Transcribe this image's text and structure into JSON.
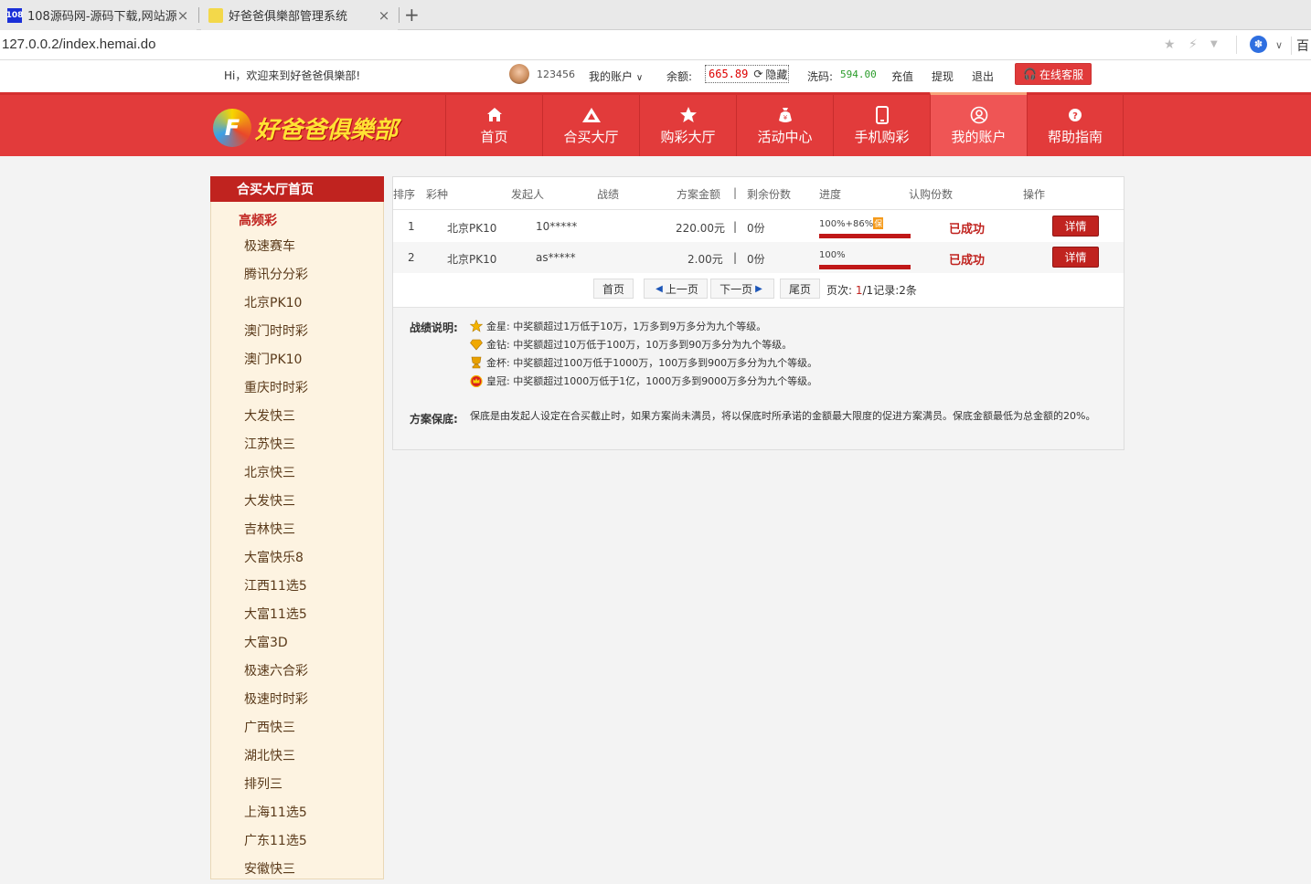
{
  "browser": {
    "tabs": [
      {
        "favicon": "108",
        "title": "108源码网-源码下载,网站源码"
      },
      {
        "favicon": "",
        "title": "好爸爸俱樂部管理系统"
      }
    ],
    "url": "127.0.0.2/index.hemai.do",
    "right_text": "百"
  },
  "topbar": {
    "welcome": "Hi，欢迎来到好爸爸俱樂部!",
    "username": "123456",
    "my_account": "我的账户",
    "balance_label": "余额:",
    "balance": "665.89",
    "hide": "隐藏",
    "xima_label": "洗码:",
    "xima_value": "594.00",
    "recharge": "充值",
    "withdraw": "提现",
    "logout": "退出",
    "service": "在线客服"
  },
  "logo": {
    "mark": "F",
    "text": "好爸爸俱樂部"
  },
  "nav": [
    {
      "label": "首页",
      "icon": "home-icon"
    },
    {
      "label": "合买大厅",
      "icon": "triangle-icon"
    },
    {
      "label": "购彩大厅",
      "icon": "star-icon"
    },
    {
      "label": "活动中心",
      "icon": "moneybag-icon"
    },
    {
      "label": "手机购彩",
      "icon": "phone-icon"
    },
    {
      "label": "我的账户",
      "icon": "user-icon"
    },
    {
      "label": "帮助指南",
      "icon": "help-icon"
    }
  ],
  "sidebar": {
    "head": "合买大厅首页",
    "category": "高频彩",
    "items": [
      "极速赛车",
      "腾讯分分彩",
      "北京PK10",
      "澳门时时彩",
      "澳门PK10",
      "重庆时时彩",
      "大发快三",
      "江苏快三",
      "北京快三",
      "大发快三",
      "吉林快三",
      "大富快乐8",
      "江西11选5",
      "大富11选5",
      "大富3D",
      "极速六合彩",
      "极速时时彩",
      "广西快三",
      "湖北快三",
      "排列三",
      "上海11选5",
      "广东11选5",
      "安徽快三"
    ]
  },
  "table": {
    "headers": [
      "排序",
      "彩种",
      "发起人",
      "战绩",
      "方案金额",
      "|",
      "剩余份数",
      "进度",
      "认购份数",
      "操作"
    ],
    "rows": [
      {
        "rank": "1",
        "game": "北京PK10",
        "starter": "10*****",
        "amount": "220.00元",
        "sep": "|",
        "remain": "0份",
        "progress": "100%+86%",
        "bao": "保",
        "progress_pct": 1.0,
        "status": "已成功",
        "action": "详情"
      },
      {
        "rank": "2",
        "game": "北京PK10",
        "starter": "as*****",
        "amount": "2.00元",
        "sep": "|",
        "remain": "0份",
        "progress": "100%",
        "bao": "",
        "progress_pct": 1.0,
        "status": "已成功",
        "action": "详情"
      }
    ]
  },
  "pager": {
    "first": "首页",
    "prev": "上一页",
    "next": "下一页",
    "last": "尾页",
    "page_label": "页次:",
    "page": "1",
    "page_total": "/1",
    "records_label": "记录:",
    "records": "2条"
  },
  "legend": {
    "title": "战绩说明:",
    "items": [
      {
        "icon": "gold-star-icon",
        "color": "#f5b400",
        "text": "金星: 中奖额超过1万低于10万，1万多到9万多分为九个等级。"
      },
      {
        "icon": "gold-diamond-icon",
        "color": "#f0a800",
        "text": "金钻: 中奖额超过10万低于100万，10万多到90万多分为九个等级。"
      },
      {
        "icon": "gold-cup-icon",
        "color": "#e8a000",
        "text": "金杯: 中奖额超过100万低于1000万，100万多到900万多分为九个等级。"
      },
      {
        "icon": "crown-icon",
        "color": "#d81e1e",
        "text": "皇冠: 中奖额超过1000万低于1亿，1000万多到9000万多分为九个等级。"
      }
    ],
    "guarantee_title": "方案保底:",
    "guarantee_text": "保底是由发起人设定在合买截止时，如果方案尚未满员，将以保底时所承诺的金额最大限度的促进方案满员。保底金额最低为总金额的20%。"
  }
}
